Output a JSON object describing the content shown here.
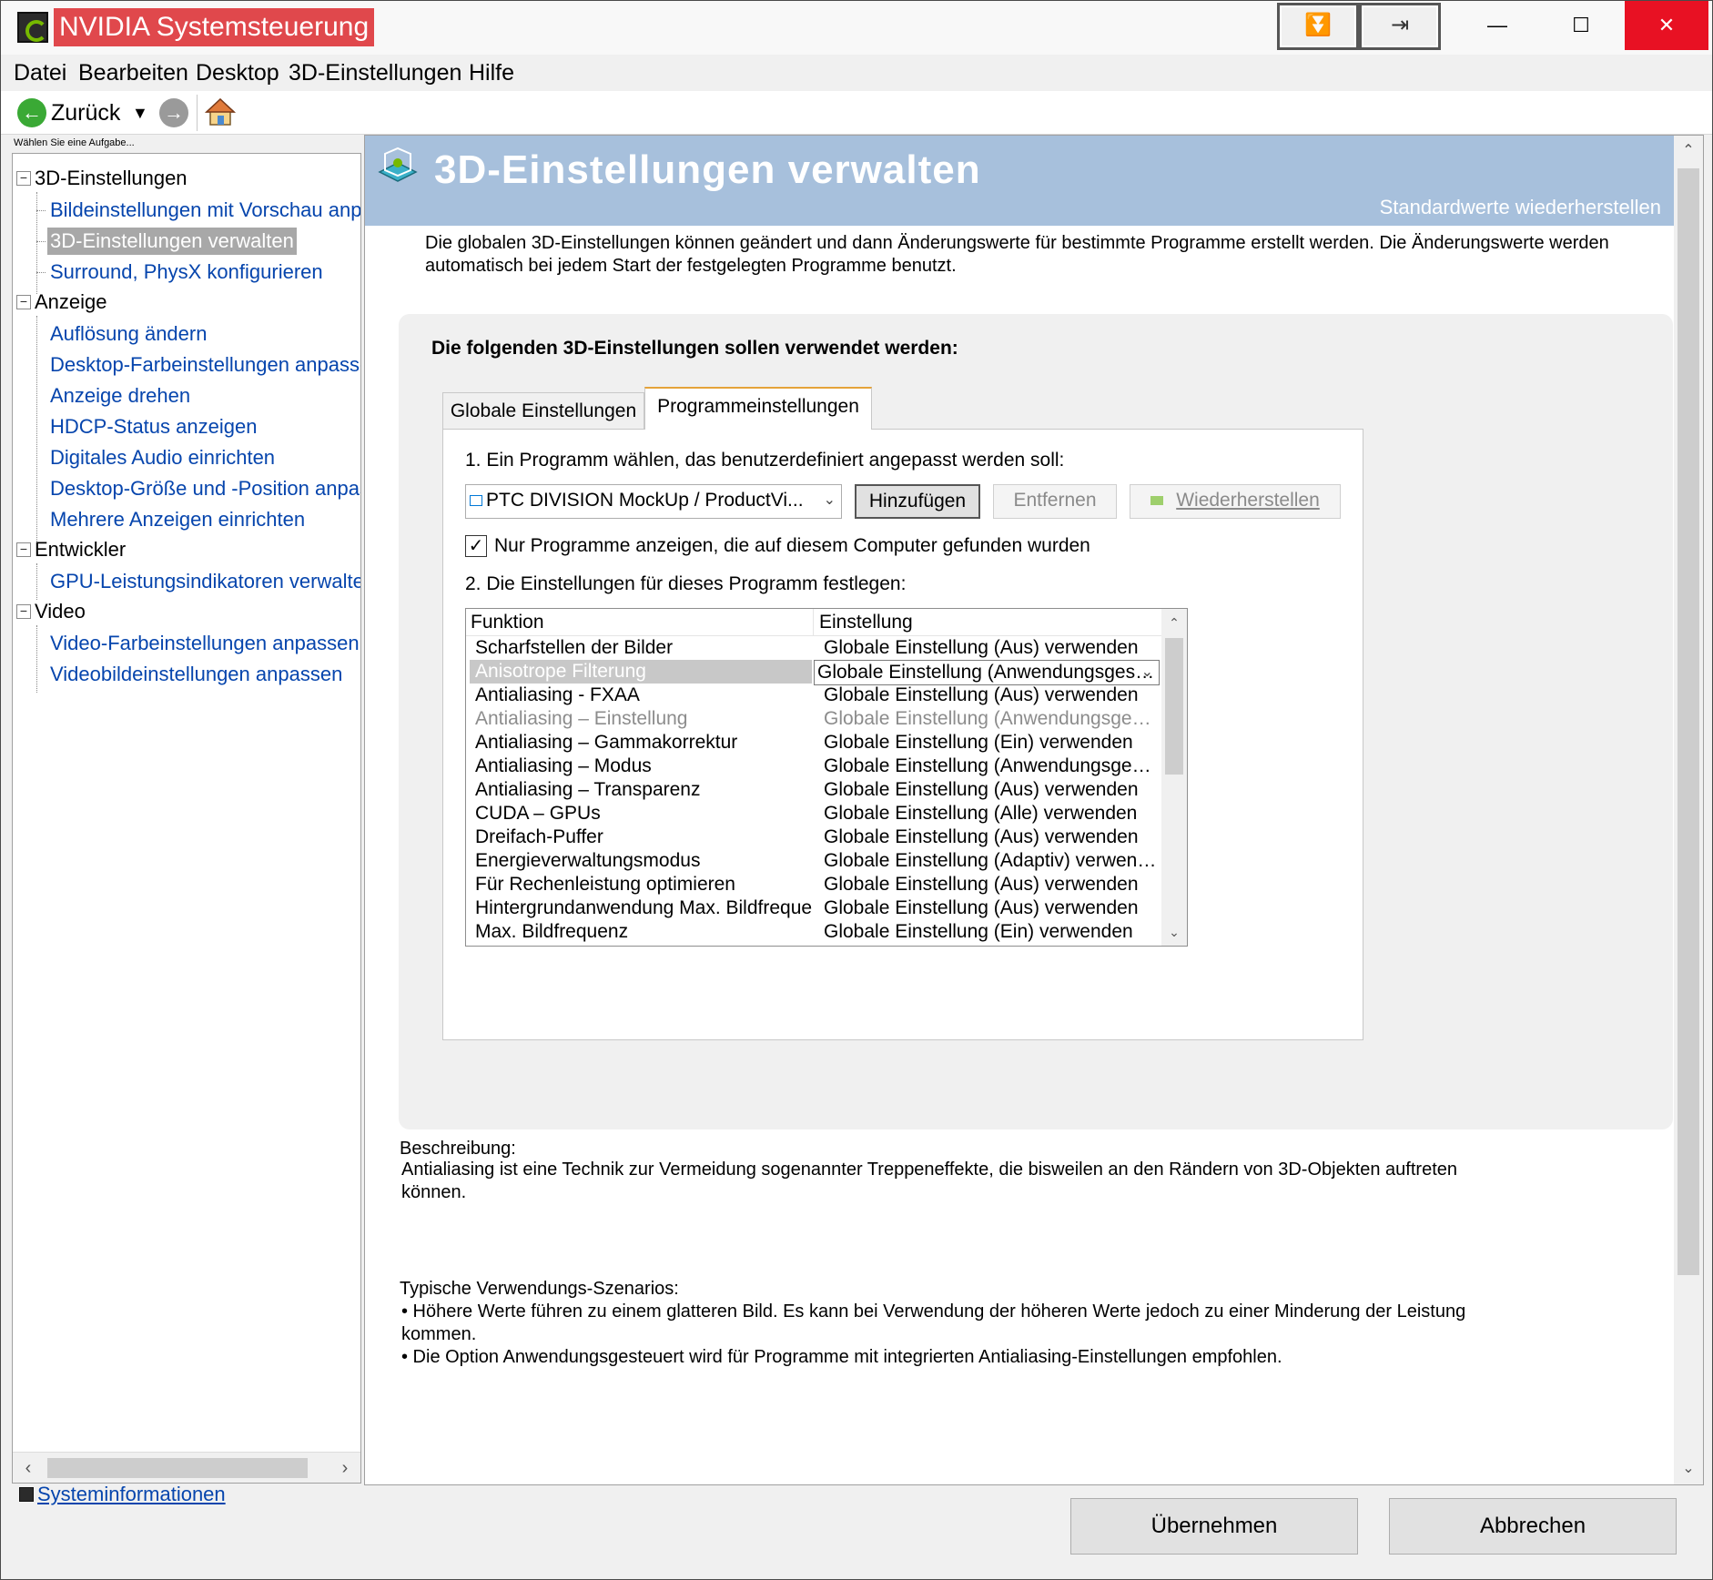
{
  "window": {
    "title": "NVIDIA Systemsteuerung",
    "controls": {
      "minimize": "—",
      "maximize": "☐",
      "close": "✕"
    },
    "tool_buttons": {
      "collapse": "⏬",
      "pin": "⇥"
    }
  },
  "menubar": [
    "Datei",
    "Bearbeiten",
    "Desktop",
    "3D-Einstellungen",
    "Hilfe"
  ],
  "toolbar": {
    "back_label": "Zurück",
    "back_icon": "back-arrow-icon",
    "forward_icon": "forward-arrow-icon",
    "home_icon": "home-icon"
  },
  "sidebar": {
    "task_label": "Wählen Sie eine Aufgabe...",
    "categories": [
      {
        "label": "3D-Einstellungen",
        "items": [
          "Bildeinstellungen mit Vorschau anpa",
          "3D-Einstellungen verwalten",
          "Surround, PhysX konfigurieren"
        ]
      },
      {
        "label": "Anzeige",
        "items": [
          "Auflösung ändern",
          "Desktop-Farbeinstellungen anpassen",
          "Anzeige drehen",
          "HDCP-Status anzeigen",
          "Digitales Audio einrichten",
          "Desktop-Größe und -Position anpass",
          "Mehrere Anzeigen einrichten"
        ]
      },
      {
        "label": "Entwickler",
        "items": [
          "GPU-Leistungsindikatoren verwalten"
        ]
      },
      {
        "label": "Video",
        "items": [
          "Video-Farbeinstellungen anpassen",
          "Videobildeinstellungen anpassen"
        ]
      }
    ],
    "selected_item": "3D-Einstellungen verwalten",
    "system_info_link": "Systeminformationen"
  },
  "main": {
    "title": "3D-Einstellungen verwalten",
    "restore_defaults": "Standardwerte wiederherstellen",
    "intro": "Die globalen 3D-Einstellungen können geändert und dann Änderungswerte für bestimmte Programme erstellt werden. Die Änderungswerte werden automatisch bei jedem Start der festgelegten Programme benutzt.",
    "group_heading": "Die folgenden 3D-Einstellungen sollen verwendet werden:",
    "tabs": [
      {
        "label": "Globale Einstellungen",
        "active": false
      },
      {
        "label": "Programmeinstellungen",
        "active": true
      }
    ],
    "step1_label": "1. Ein Programm wählen, das benutzerdefiniert angepasst werden soll:",
    "program_select_value": "PTC DIVISION MockUp / ProductVi...",
    "buttons": {
      "add": "Hinzufügen",
      "remove": "Entfernen",
      "restore": "Wiederherstellen"
    },
    "only_found_checkbox": {
      "label": "Nur Programme anzeigen, die auf diesem Computer gefunden wurden",
      "checked": true
    },
    "step2_label": "2. Die Einstellungen für dieses Programm festlegen:",
    "table": {
      "columns": [
        "Funktion",
        "Einstellung"
      ],
      "rows": [
        {
          "func": "Scharfstellen der Bilder",
          "setting": "Globale Einstellung (Aus) verwenden",
          "state": "normal"
        },
        {
          "func": "Anisotrope Filterung",
          "setting": "Globale Einstellung (Anwendungsgesteuert)",
          "state": "selected"
        },
        {
          "func": "Antialiasing - FXAA",
          "setting": "Globale Einstellung (Aus) verwenden",
          "state": "normal"
        },
        {
          "func": "Antialiasing – Einstellung",
          "setting": "Globale Einstellung (Anwendungsgesteuert)...",
          "state": "disabled"
        },
        {
          "func": "Antialiasing – Gammakorrektur",
          "setting": "Globale Einstellung (Ein) verwenden",
          "state": "normal"
        },
        {
          "func": "Antialiasing – Modus",
          "setting": "Globale Einstellung (Anwendungsgesteuert)...",
          "state": "normal"
        },
        {
          "func": "Antialiasing – Transparenz",
          "setting": "Globale Einstellung (Aus) verwenden",
          "state": "normal"
        },
        {
          "func": "CUDA – GPUs",
          "setting": "Globale Einstellung (Alle) verwenden",
          "state": "normal"
        },
        {
          "func": "Dreifach-Puffer",
          "setting": "Globale Einstellung (Aus) verwenden",
          "state": "normal"
        },
        {
          "func": "Energieverwaltungsmodus",
          "setting": "Globale Einstellung (Adaptiv) verwenden",
          "state": "normal"
        },
        {
          "func": "Für Rechenleistung optimieren",
          "setting": "Globale Einstellung (Aus) verwenden",
          "state": "normal"
        },
        {
          "func": "Hintergrundanwendung Max. Bildfrequenz",
          "setting": "Globale Einstellung (Aus) verwenden",
          "state": "normal"
        },
        {
          "func": "Max. Bildfrequenz",
          "setting": "Globale Einstellung (Ein) verwenden",
          "state": "normal"
        }
      ]
    },
    "description_label": "Beschreibung:",
    "description": "Antialiasing ist eine Technik zur Vermeidung sogenannter Treppeneffekte, die bisweilen an den Rändern von 3D-Objekten auftreten können.",
    "usage_label": "Typische Verwendungs-Szenarios:",
    "usage_items": [
      "• Höhere Werte führen zu einem glatteren Bild. Es kann bei Verwendung der höheren Werte jedoch zu einer Minderung der Leistung kommen.",
      "• Die Option Anwendungsgesteuert wird für Programme mit integrierten Antialiasing-Einstellungen empfohlen."
    ]
  },
  "footer": {
    "apply": "Übernehmen",
    "cancel": "Abbrechen"
  },
  "colors": {
    "banner": "#a7c0dc",
    "title_highlight": "#e0484c",
    "link": "#0645ad",
    "close_button": "#e81123",
    "nvidia_green": "#76b900"
  }
}
